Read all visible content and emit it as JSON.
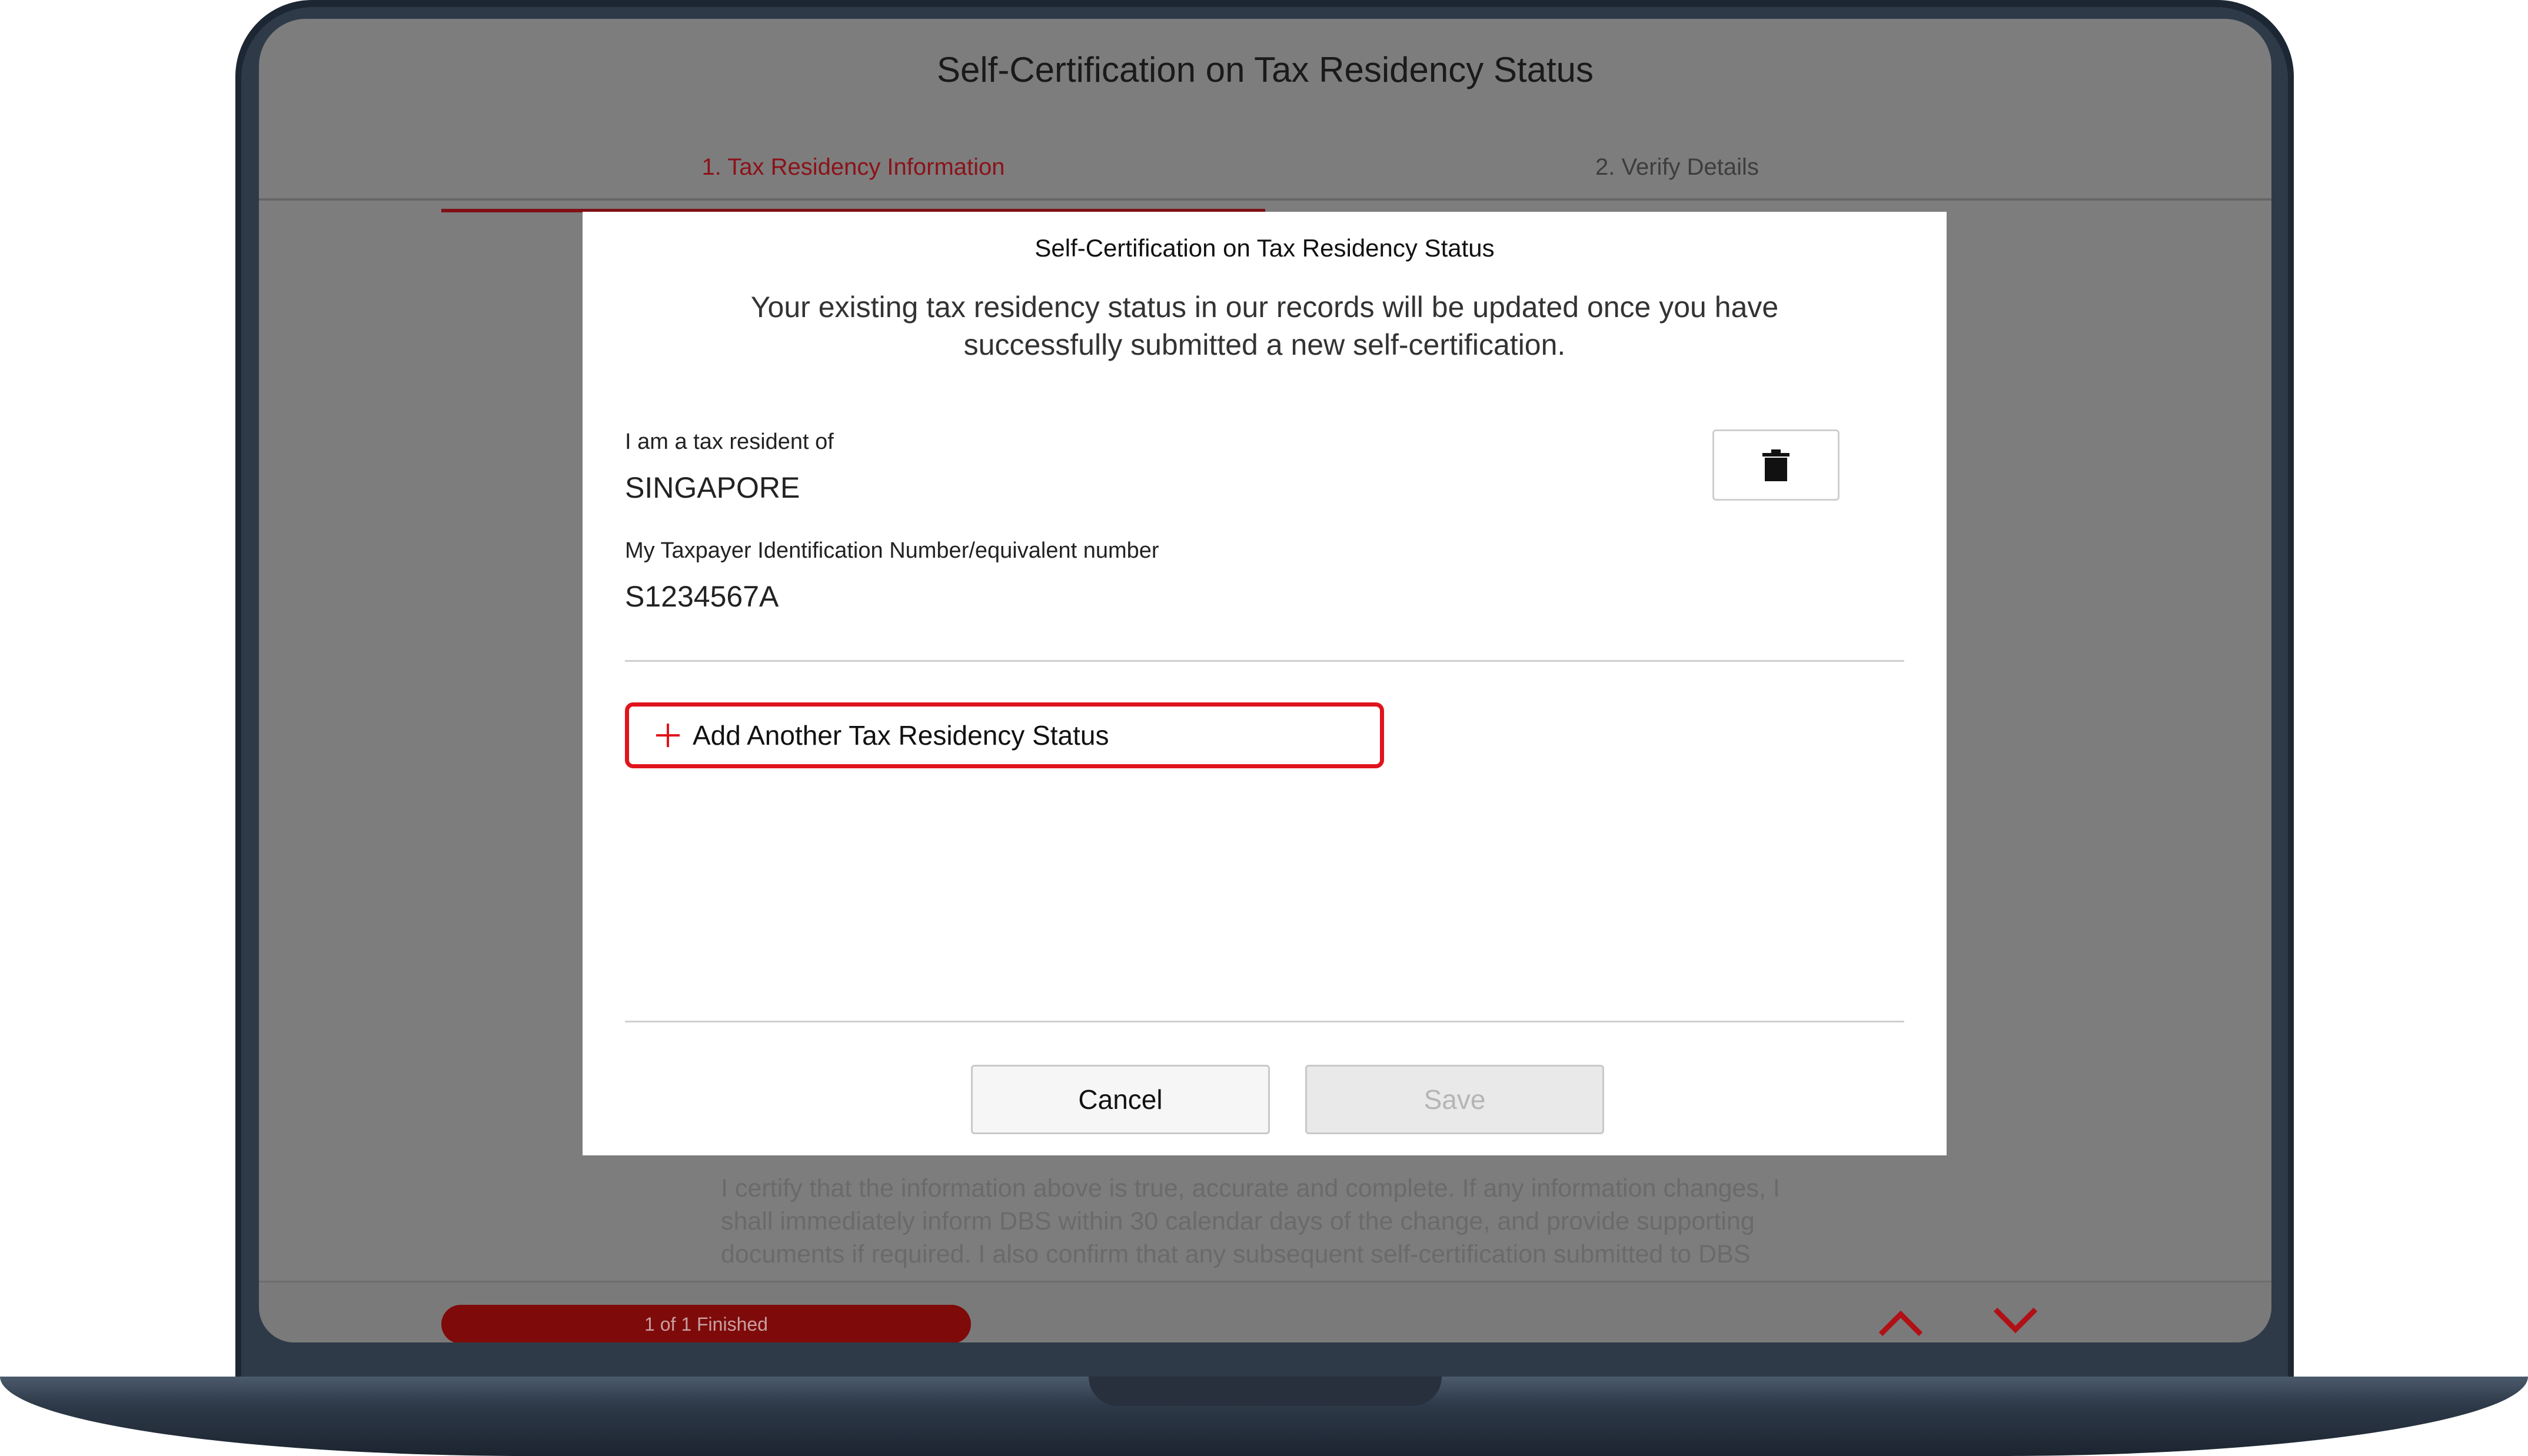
{
  "page": {
    "title": "Self-Certification on Tax Residency Status",
    "steps": [
      {
        "label": "1. Tax Residency Information",
        "active": true
      },
      {
        "label": "2. Verify Details",
        "active": false
      }
    ],
    "certification_text": "I certify that the information above is true, accurate and complete. If any information changes, I shall immediately inform DBS within 30 calendar days of the change, and provide supporting documents if required. I also confirm that any subsequent self-certification submitted to DBS",
    "progress_label": "1 of 1 Finished"
  },
  "modal": {
    "title": "Self-Certification on Tax Residency Status",
    "notice": "Your existing tax residency status in our records will be updated once you have successfully submitted a new self-certification.",
    "country_label": "I am a tax resident of",
    "country_value": "SINGAPORE",
    "tin_label": "My Taxpayer Identification Number/equivalent number",
    "tin_value": "S1234567A",
    "add_button_label": "Add Another Tax Residency Status",
    "cancel_label": "Cancel",
    "save_label": "Save"
  },
  "colors": {
    "accent": "#e0141c",
    "brand_dark_red": "#7e0a0a"
  },
  "icons": {
    "delete": "trash-icon",
    "add": "plus-icon",
    "nav_up": "chevron-up-icon",
    "nav_down": "chevron-down-icon"
  }
}
